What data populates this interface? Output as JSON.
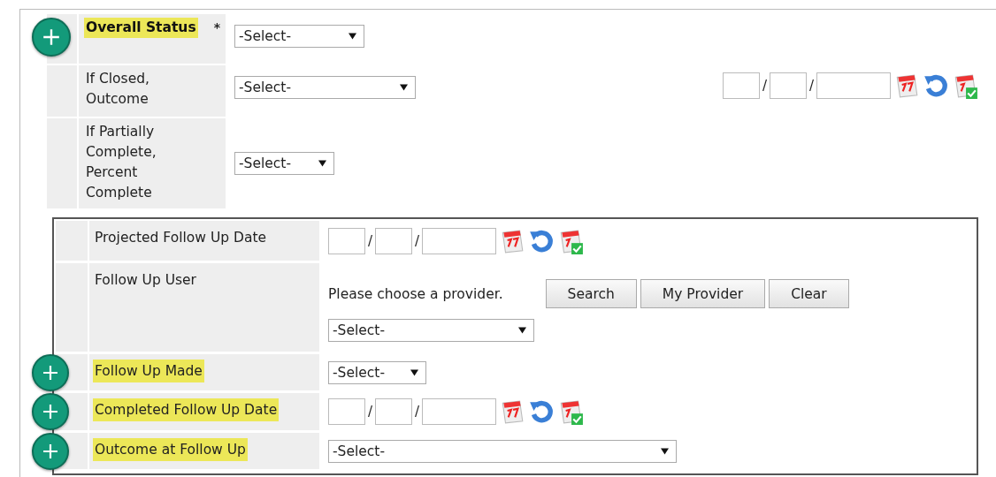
{
  "outer_rows": [
    {
      "label": "Overall Status",
      "highlighted": true,
      "bold": true,
      "required_mark": "*",
      "add_button": true,
      "kind": "select",
      "select": "-Select-"
    },
    {
      "label": "If Closed, Outcome",
      "highlighted": false,
      "bold": false,
      "add_button": false,
      "kind": "select_date",
      "select": "-Select-",
      "separators": [
        "/",
        "/"
      ]
    },
    {
      "label": "If Partially Complete, Percent Complete",
      "highlighted": false,
      "bold": false,
      "add_button": false,
      "kind": "select",
      "select": "-Select-"
    }
  ],
  "followup_rows": [
    {
      "label": "Projected Follow Up Date",
      "highlighted": false,
      "add_button": false,
      "kind": "date",
      "separators": [
        "/",
        "/"
      ]
    },
    {
      "label": "Follow Up User",
      "highlighted": false,
      "add_button": false,
      "kind": "provider",
      "prompt": "Please choose a provider.",
      "buttons": [
        "Search",
        "My Provider",
        "Clear"
      ],
      "select": "-Select-"
    },
    {
      "label": "Follow Up Made",
      "highlighted": true,
      "add_button": true,
      "kind": "select",
      "select": "-Select-"
    },
    {
      "label": "Completed Follow Up Date",
      "highlighted": true,
      "add_button": true,
      "kind": "date",
      "separators": [
        "/",
        "/"
      ]
    },
    {
      "label": "Outcome at Follow Up",
      "highlighted": true,
      "add_button": true,
      "kind": "select",
      "select": "-Select-"
    }
  ]
}
